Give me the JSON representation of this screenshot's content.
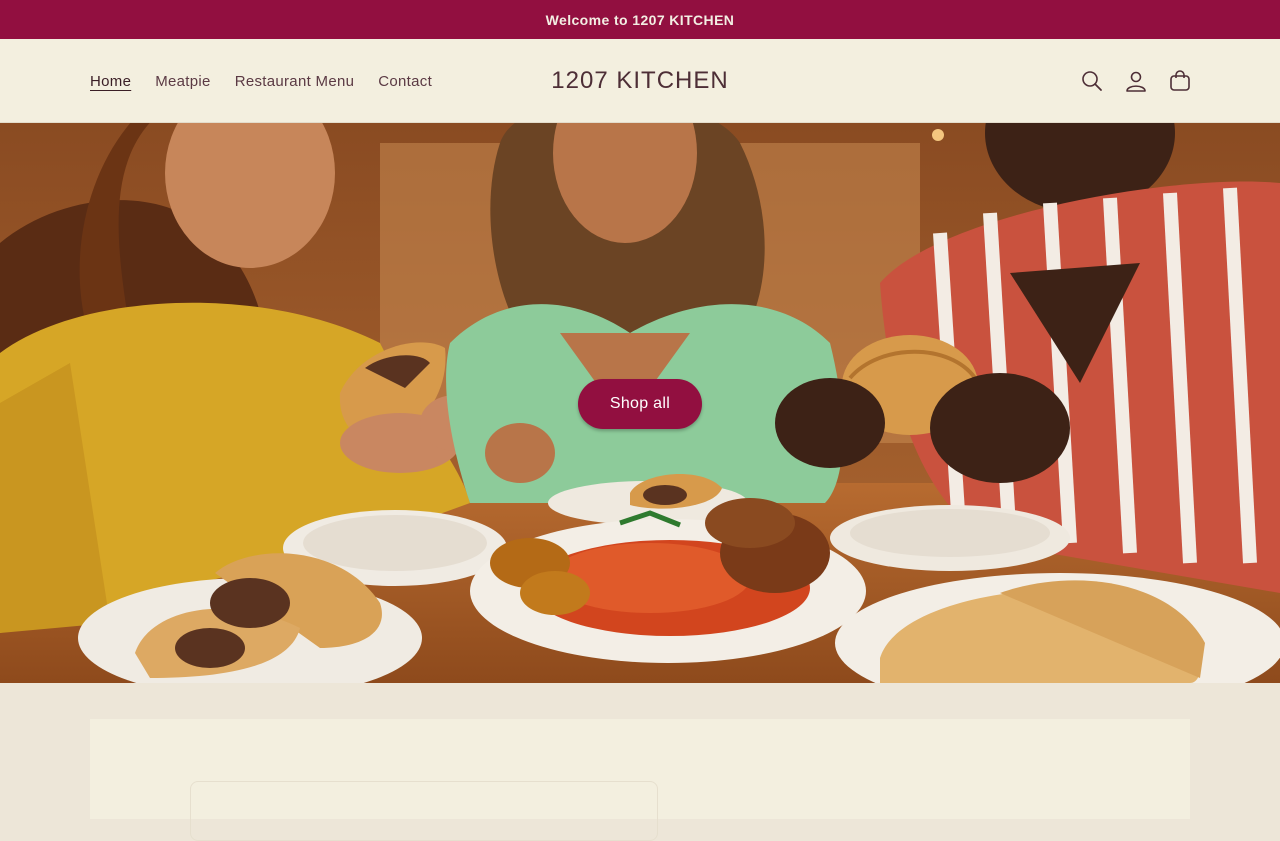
{
  "announcement": {
    "text": "Welcome to 1207 KITCHEN"
  },
  "header": {
    "logo": "1207 KITCHEN",
    "nav": [
      {
        "label": "Home",
        "active": true
      },
      {
        "label": "Meatpie",
        "active": false
      },
      {
        "label": "Restaurant Menu",
        "active": false
      },
      {
        "label": "Contact",
        "active": false
      }
    ],
    "icons": [
      "search-icon",
      "account-icon",
      "cart-icon"
    ]
  },
  "hero": {
    "button_label": "Shop all",
    "image_subject": "friends-eating-meat-pies-and-jollof-rice"
  },
  "colors": {
    "brand": "#920f40",
    "header_bg": "#f3efdf",
    "page_bg": "#ede6d8",
    "text": "#4d2e36"
  }
}
